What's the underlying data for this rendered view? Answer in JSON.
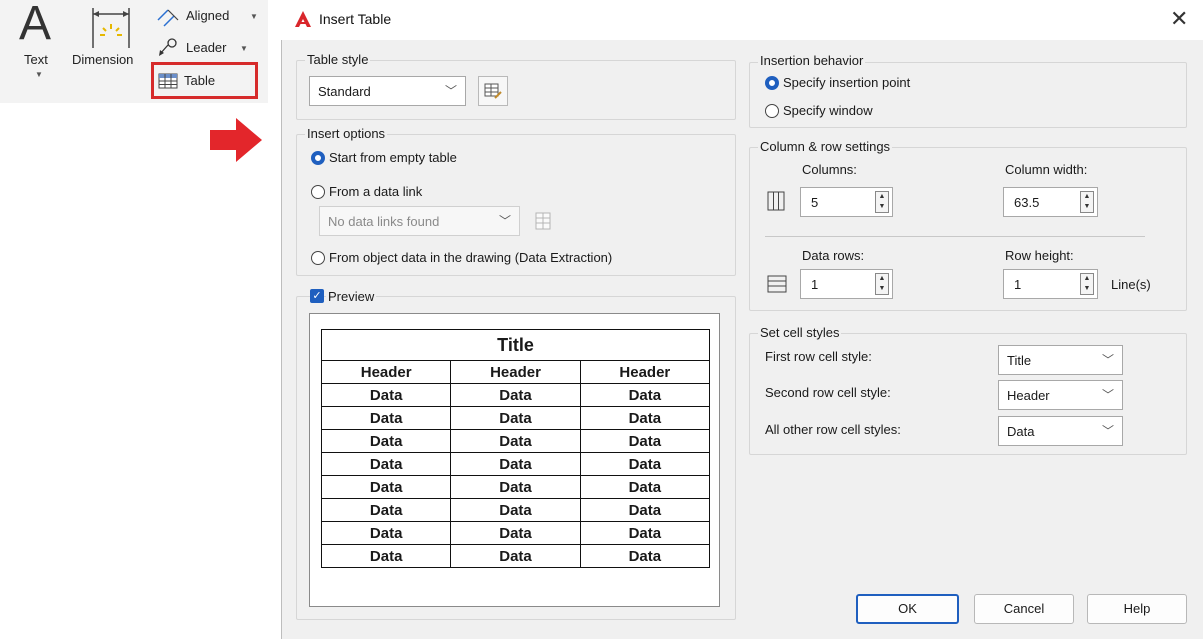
{
  "ribbon": {
    "text_label": "Text",
    "dimension_label": "Dimension",
    "aligned_label": "Aligned",
    "leader_label": "Leader",
    "table_label": "Table"
  },
  "dialog": {
    "title": "Insert Table",
    "table_style": {
      "label": "Table style",
      "value": "Standard"
    },
    "insert_options": {
      "label": "Insert options",
      "empty_table": "Start from empty table",
      "data_link": "From a data link",
      "data_link_value": "No data links found",
      "object_data": "From object data in the drawing (Data Extraction)"
    },
    "preview": {
      "label": "Preview",
      "title": "Title",
      "headers": [
        "Header",
        "Header",
        "Header"
      ],
      "data_cell": "Data"
    },
    "insertion_behavior": {
      "label": "Insertion behavior",
      "point": "Specify insertion point",
      "window": "Specify window"
    },
    "column_row": {
      "label": "Column & row settings",
      "columns_label": "Columns:",
      "columns_value": "5",
      "col_width_label": "Column width:",
      "col_width_value": "63.5",
      "data_rows_label": "Data rows:",
      "data_rows_value": "1",
      "row_height_label": "Row height:",
      "row_height_value": "1",
      "row_height_unit": "Line(s)"
    },
    "cell_styles": {
      "label": "Set cell styles",
      "first_label": "First row cell style:",
      "first_value": "Title",
      "second_label": "Second row cell style:",
      "second_value": "Header",
      "other_label": "All other row cell styles:",
      "other_value": "Data"
    },
    "buttons": {
      "ok": "OK",
      "cancel": "Cancel",
      "help": "Help"
    }
  },
  "colors": {
    "accent": "#1f5fbf",
    "highlight": "#d62b2b",
    "arrow": "#e3262b"
  }
}
